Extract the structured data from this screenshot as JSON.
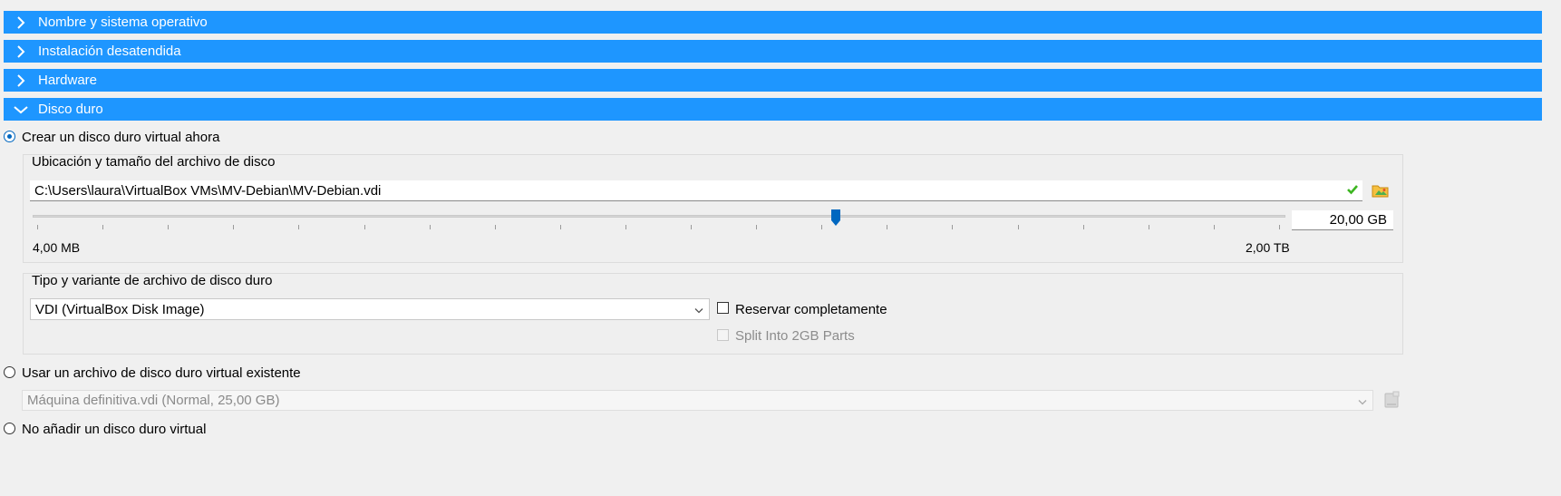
{
  "sections": [
    {
      "label": "Nombre y sistema operativo",
      "expanded": false
    },
    {
      "label": "Instalación desatendida",
      "expanded": false
    },
    {
      "label": "Hardware",
      "expanded": false
    },
    {
      "label": "Disco duro",
      "expanded": true
    }
  ],
  "options": {
    "create_new": {
      "label": "Crear un disco duro virtual ahora",
      "selected": true
    },
    "use_existing": {
      "label": "Usar un archivo de disco duro virtual existente",
      "selected": false
    },
    "no_disk": {
      "label": "No añadir un disco duro virtual",
      "selected": false
    }
  },
  "location_group": {
    "title": "Ubicación y tamaño del archivo de disco",
    "path": "C:\\Users\\laura\\VirtualBox VMs\\MV-Debian\\MV-Debian.vdi",
    "size_value": "20,00 GB",
    "slider_min_label": "4,00 MB",
    "slider_max_label": "2,00 TB",
    "slider_fraction": 0.641,
    "slider_ticks": 20
  },
  "type_group": {
    "title": "Tipo y variante de archivo de disco duro",
    "disk_type": "VDI (VirtualBox Disk Image)",
    "reserve_label": "Reservar completamente",
    "reserve_checked": false,
    "split_label": "Split Into 2GB Parts",
    "split_checked": false,
    "split_enabled": false
  },
  "existing_disk": {
    "value": "Máquina definitiva.vdi (Normal, 25,00 GB)",
    "enabled": false
  },
  "colors": {
    "section_bar": "#1e96ff",
    "accent": "#0067c0",
    "valid_check": "#3cb521",
    "folder_icon": "#f5c040"
  },
  "icons": {
    "valid": "check-icon",
    "choose_file": "folder-icon",
    "choose_existing": "disk-icon"
  }
}
